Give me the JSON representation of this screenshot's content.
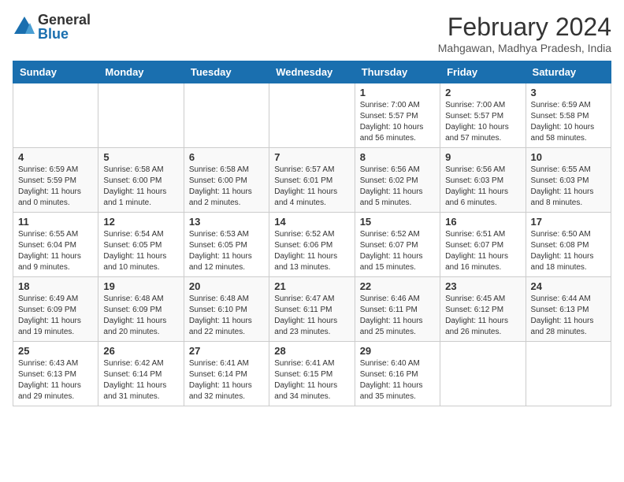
{
  "logo": {
    "general": "General",
    "blue": "Blue"
  },
  "header": {
    "month_year": "February 2024",
    "location": "Mahgawan, Madhya Pradesh, India"
  },
  "weekdays": [
    "Sunday",
    "Monday",
    "Tuesday",
    "Wednesday",
    "Thursday",
    "Friday",
    "Saturday"
  ],
  "rows": [
    {
      "cells": [
        {
          "day": "",
          "info": ""
        },
        {
          "day": "",
          "info": ""
        },
        {
          "day": "",
          "info": ""
        },
        {
          "day": "",
          "info": ""
        },
        {
          "day": "1",
          "info": "Sunrise: 7:00 AM\nSunset: 5:57 PM\nDaylight: 10 hours\nand 56 minutes."
        },
        {
          "day": "2",
          "info": "Sunrise: 7:00 AM\nSunset: 5:57 PM\nDaylight: 10 hours\nand 57 minutes."
        },
        {
          "day": "3",
          "info": "Sunrise: 6:59 AM\nSunset: 5:58 PM\nDaylight: 10 hours\nand 58 minutes."
        }
      ]
    },
    {
      "cells": [
        {
          "day": "4",
          "info": "Sunrise: 6:59 AM\nSunset: 5:59 PM\nDaylight: 11 hours\nand 0 minutes."
        },
        {
          "day": "5",
          "info": "Sunrise: 6:58 AM\nSunset: 6:00 PM\nDaylight: 11 hours\nand 1 minute."
        },
        {
          "day": "6",
          "info": "Sunrise: 6:58 AM\nSunset: 6:00 PM\nDaylight: 11 hours\nand 2 minutes."
        },
        {
          "day": "7",
          "info": "Sunrise: 6:57 AM\nSunset: 6:01 PM\nDaylight: 11 hours\nand 4 minutes."
        },
        {
          "day": "8",
          "info": "Sunrise: 6:56 AM\nSunset: 6:02 PM\nDaylight: 11 hours\nand 5 minutes."
        },
        {
          "day": "9",
          "info": "Sunrise: 6:56 AM\nSunset: 6:03 PM\nDaylight: 11 hours\nand 6 minutes."
        },
        {
          "day": "10",
          "info": "Sunrise: 6:55 AM\nSunset: 6:03 PM\nDaylight: 11 hours\nand 8 minutes."
        }
      ]
    },
    {
      "cells": [
        {
          "day": "11",
          "info": "Sunrise: 6:55 AM\nSunset: 6:04 PM\nDaylight: 11 hours\nand 9 minutes."
        },
        {
          "day": "12",
          "info": "Sunrise: 6:54 AM\nSunset: 6:05 PM\nDaylight: 11 hours\nand 10 minutes."
        },
        {
          "day": "13",
          "info": "Sunrise: 6:53 AM\nSunset: 6:05 PM\nDaylight: 11 hours\nand 12 minutes."
        },
        {
          "day": "14",
          "info": "Sunrise: 6:52 AM\nSunset: 6:06 PM\nDaylight: 11 hours\nand 13 minutes."
        },
        {
          "day": "15",
          "info": "Sunrise: 6:52 AM\nSunset: 6:07 PM\nDaylight: 11 hours\nand 15 minutes."
        },
        {
          "day": "16",
          "info": "Sunrise: 6:51 AM\nSunset: 6:07 PM\nDaylight: 11 hours\nand 16 minutes."
        },
        {
          "day": "17",
          "info": "Sunrise: 6:50 AM\nSunset: 6:08 PM\nDaylight: 11 hours\nand 18 minutes."
        }
      ]
    },
    {
      "cells": [
        {
          "day": "18",
          "info": "Sunrise: 6:49 AM\nSunset: 6:09 PM\nDaylight: 11 hours\nand 19 minutes."
        },
        {
          "day": "19",
          "info": "Sunrise: 6:48 AM\nSunset: 6:09 PM\nDaylight: 11 hours\nand 20 minutes."
        },
        {
          "day": "20",
          "info": "Sunrise: 6:48 AM\nSunset: 6:10 PM\nDaylight: 11 hours\nand 22 minutes."
        },
        {
          "day": "21",
          "info": "Sunrise: 6:47 AM\nSunset: 6:11 PM\nDaylight: 11 hours\nand 23 minutes."
        },
        {
          "day": "22",
          "info": "Sunrise: 6:46 AM\nSunset: 6:11 PM\nDaylight: 11 hours\nand 25 minutes."
        },
        {
          "day": "23",
          "info": "Sunrise: 6:45 AM\nSunset: 6:12 PM\nDaylight: 11 hours\nand 26 minutes."
        },
        {
          "day": "24",
          "info": "Sunrise: 6:44 AM\nSunset: 6:13 PM\nDaylight: 11 hours\nand 28 minutes."
        }
      ]
    },
    {
      "cells": [
        {
          "day": "25",
          "info": "Sunrise: 6:43 AM\nSunset: 6:13 PM\nDaylight: 11 hours\nand 29 minutes."
        },
        {
          "day": "26",
          "info": "Sunrise: 6:42 AM\nSunset: 6:14 PM\nDaylight: 11 hours\nand 31 minutes."
        },
        {
          "day": "27",
          "info": "Sunrise: 6:41 AM\nSunset: 6:14 PM\nDaylight: 11 hours\nand 32 minutes."
        },
        {
          "day": "28",
          "info": "Sunrise: 6:41 AM\nSunset: 6:15 PM\nDaylight: 11 hours\nand 34 minutes."
        },
        {
          "day": "29",
          "info": "Sunrise: 6:40 AM\nSunset: 6:16 PM\nDaylight: 11 hours\nand 35 minutes."
        },
        {
          "day": "",
          "info": ""
        },
        {
          "day": "",
          "info": ""
        }
      ]
    }
  ]
}
